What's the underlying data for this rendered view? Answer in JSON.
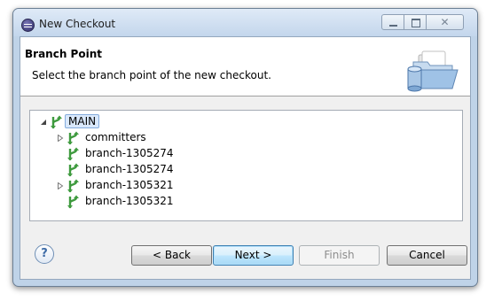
{
  "window": {
    "title": "New Checkout",
    "close_glyph": "✕"
  },
  "header": {
    "title": "Branch Point",
    "description": "Select the branch point of the new checkout.",
    "image_icon": "folder-database-icon"
  },
  "tree": {
    "nodes": [
      {
        "label": "MAIN",
        "level": 0,
        "toggle": "expanded",
        "selected": true,
        "icon": "branch-icon"
      },
      {
        "label": "committers",
        "level": 1,
        "toggle": "collapsed",
        "selected": false,
        "icon": "branch-icon"
      },
      {
        "label": "branch-1305274",
        "level": 1,
        "toggle": "none",
        "selected": false,
        "icon": "branch-icon"
      },
      {
        "label": "branch-1305274",
        "level": 1,
        "toggle": "none",
        "selected": false,
        "icon": "branch-icon"
      },
      {
        "label": "branch-1305321",
        "level": 1,
        "toggle": "collapsed",
        "selected": false,
        "icon": "branch-icon"
      },
      {
        "label": "branch-1305321",
        "level": 1,
        "toggle": "none",
        "selected": false,
        "icon": "branch-icon"
      }
    ]
  },
  "footer": {
    "help_glyph": "?",
    "back_label": "< Back",
    "next_label": "Next >",
    "finish_label": "Finish",
    "cancel_label": "Cancel"
  },
  "colors": {
    "branch_icon": "#3e9a3e",
    "selection": "#d9e8fb",
    "window_frame": "#bfd3e8"
  }
}
